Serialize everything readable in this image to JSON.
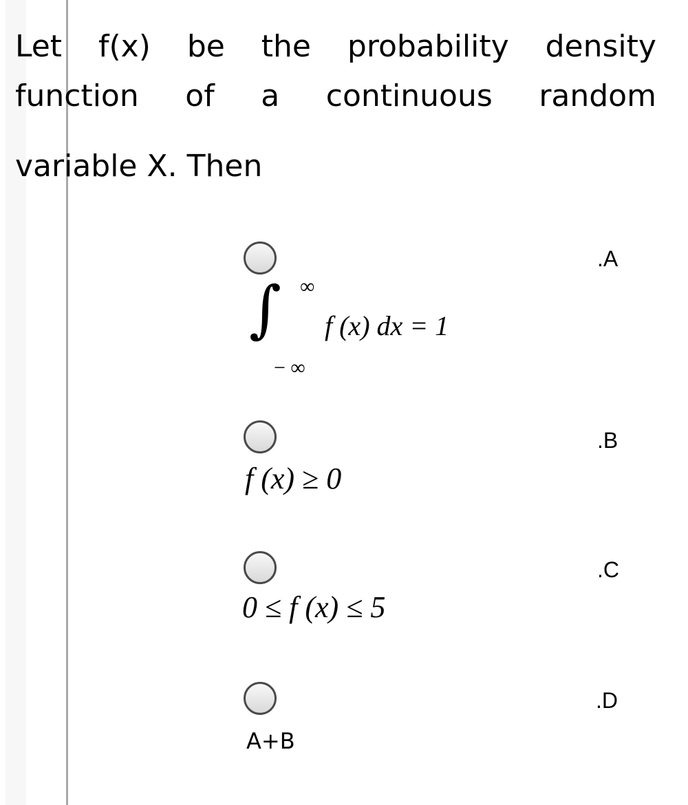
{
  "question": {
    "line1": [
      "Let",
      "f(x)",
      "be",
      "the",
      "probability",
      "density"
    ],
    "line2": [
      "function",
      "of",
      "a",
      "continuous",
      "random"
    ],
    "line3": "variable X. Then"
  },
  "options": [
    {
      "letter": ".A",
      "formula": {
        "integral": "∫",
        "upper": "∞",
        "lower": "− ∞",
        "integrand": "f (x) dx = 1"
      }
    },
    {
      "letter": ".B",
      "formula_text": "f (x) ≥ 0"
    },
    {
      "letter": ".C",
      "formula_text": "0 ≤ f (x) ≤ 5"
    },
    {
      "letter": ".D",
      "text": "A+B"
    }
  ]
}
